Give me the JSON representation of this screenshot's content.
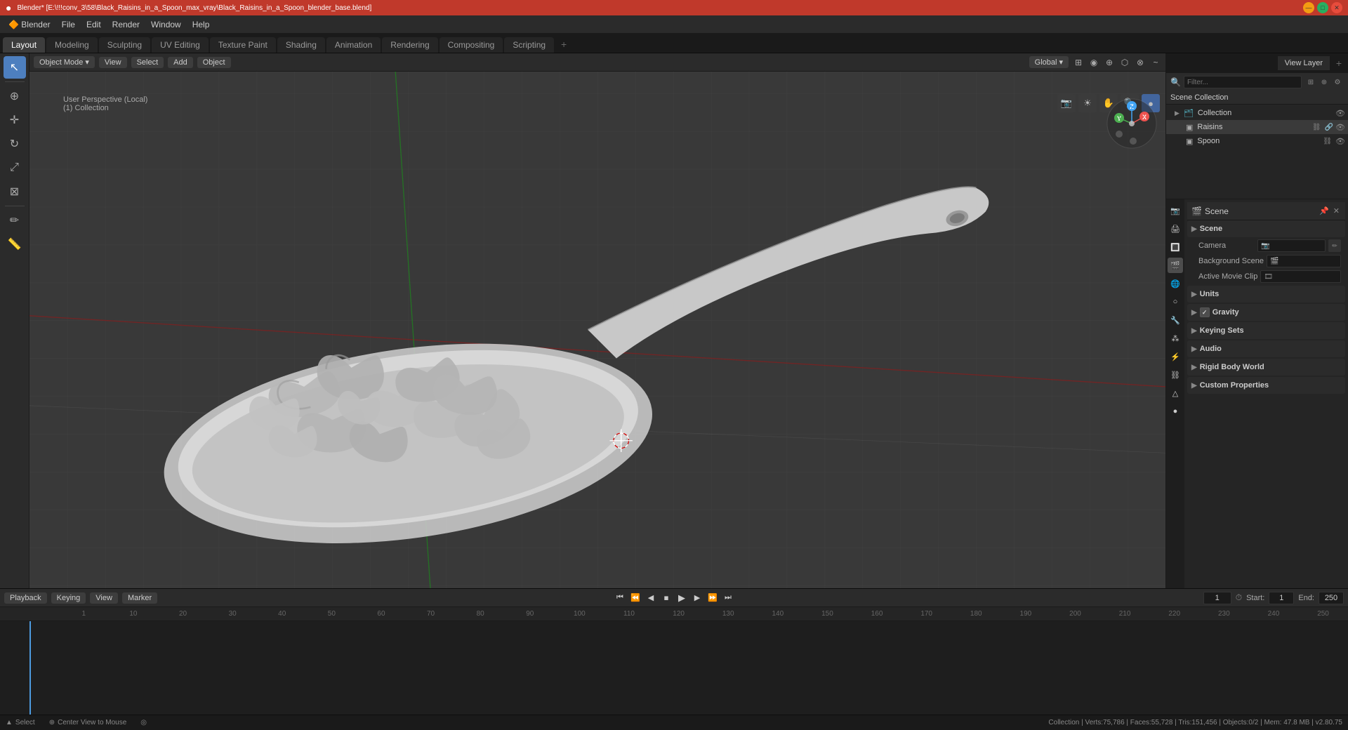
{
  "titlebar": {
    "title": "Blender* [E:\\!!!conv_3\\58\\Black_Raisins_in_a_Spoon_max_vray\\Black_Raisins_in_a_Spoon_blender_base.blend]",
    "minimize": "—",
    "maximize": "□",
    "close": "✕"
  },
  "menubar": {
    "items": [
      "Blender",
      "File",
      "Edit",
      "Render",
      "Window",
      "Help"
    ]
  },
  "workspace_tabs": {
    "tabs": [
      "Layout",
      "Modeling",
      "Sculpting",
      "UV Editing",
      "Texture Paint",
      "Shading",
      "Animation",
      "Rendering",
      "Compositing",
      "Scripting"
    ],
    "active": "Layout",
    "add_label": "+"
  },
  "viewport": {
    "mode_label": "Object Mode",
    "mode_dropdown": "▾",
    "view_label": "View",
    "select_label": "Select",
    "add_label": "Add",
    "object_label": "Object",
    "global_label": "Global",
    "perspective_label": "User Perspective (Local)",
    "collection_label": "(1) Collection",
    "header_icons": [
      "⊞",
      "◉",
      "⊕",
      "🔍",
      "⇔",
      "⊗",
      "~"
    ]
  },
  "nav_gizmo": {
    "x_label": "X",
    "y_label": "Y",
    "z_label": "Z"
  },
  "viewport_controls": {
    "buttons": [
      "⊞",
      "☁",
      "✋",
      "🔍",
      "●"
    ]
  },
  "outliner": {
    "header_label": "Scene Collection",
    "collection_label": "Collection",
    "items": [
      {
        "label": "Scene Collection",
        "indent": 0,
        "icon": "🗂",
        "type": "collection"
      },
      {
        "label": "Collection",
        "indent": 1,
        "icon": "🗂",
        "type": "collection",
        "visible": true
      },
      {
        "label": "Raisins",
        "indent": 2,
        "icon": "▣",
        "type": "object",
        "visible": true
      },
      {
        "label": "Spoon",
        "indent": 2,
        "icon": "▣",
        "type": "object",
        "visible": true
      }
    ]
  },
  "right_panel_top": {
    "tabs": [
      "View Layer"
    ],
    "active": "View Layer"
  },
  "properties": {
    "active_icon": "scene",
    "icons": [
      "render",
      "output",
      "view_layer",
      "scene",
      "world",
      "object",
      "modifier",
      "particles",
      "physics",
      "constraints",
      "data",
      "material",
      "shaderfx"
    ],
    "scene_label": "Scene",
    "scene_name": "Scene",
    "sections": [
      {
        "label": "Scene",
        "expanded": true,
        "rows": [
          {
            "label": "Camera",
            "value": ""
          },
          {
            "label": "Background Scene",
            "value": ""
          },
          {
            "label": "Active Movie Clip",
            "value": ""
          }
        ]
      },
      {
        "label": "Units",
        "expanded": false
      },
      {
        "label": "Gravity",
        "expanded": false,
        "checkbox": true
      },
      {
        "label": "Keying Sets",
        "expanded": false
      },
      {
        "label": "Audio",
        "expanded": false
      },
      {
        "label": "Rigid Body World",
        "expanded": false
      },
      {
        "label": "Custom Properties",
        "expanded": false
      }
    ]
  },
  "timeline": {
    "playback_label": "Playback",
    "keying_label": "Keying",
    "view_label": "View",
    "marker_label": "Marker",
    "frame_current": "1",
    "start_label": "Start:",
    "start_value": "1",
    "end_label": "End:",
    "end_value": "250",
    "controls": {
      "jump_start": "⏮",
      "prev_keyframe": "⏮",
      "prev_frame": "◀",
      "play": "▶",
      "next_frame": "▶",
      "next_keyframe": "⏭",
      "jump_end": "⏭",
      "stop": "⏹"
    },
    "ruler_marks": [
      "1",
      "50",
      "100",
      "150",
      "200",
      "250"
    ],
    "tick_values": [
      1,
      10,
      20,
      30,
      40,
      50,
      60,
      70,
      80,
      90,
      100,
      110,
      120,
      130,
      140,
      150,
      160,
      170,
      180,
      190,
      200,
      210,
      220,
      230,
      240,
      250
    ]
  },
  "statusbar": {
    "left": "▲  Select",
    "middle": "⊕  Center View to Mouse",
    "right_collection": "Collection | Verts:75,786 | Faces:55,728 | Tris:151,456 | Objects:0/2 | Mem: 47.8 MB | v2.80.75",
    "mouse_icon": "◎",
    "select_icon": "△"
  }
}
